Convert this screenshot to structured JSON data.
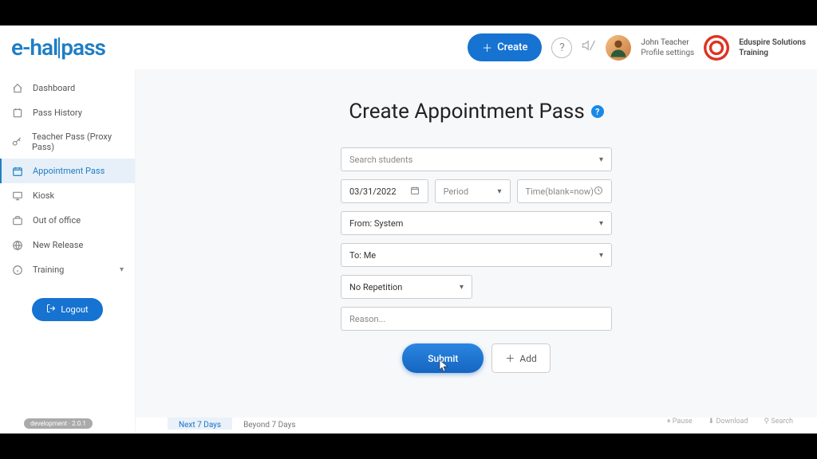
{
  "brand": "e-hallpass",
  "header": {
    "create_button": "Create",
    "user_name": "John Teacher",
    "user_sub": "Profile settings",
    "org_name": "Eduspire Solutions",
    "org_sub": "Training"
  },
  "sidebar": {
    "items": [
      {
        "label": "Dashboard"
      },
      {
        "label": "Pass History"
      },
      {
        "label": "Teacher Pass (Proxy Pass)"
      },
      {
        "label": "Appointment Pass"
      },
      {
        "label": "Kiosk"
      },
      {
        "label": "Out of office"
      },
      {
        "label": "New Release"
      },
      {
        "label": "Training"
      }
    ],
    "logout": "Logout",
    "badge": "development · 2.0.1"
  },
  "page": {
    "title": "Create Appointment Pass",
    "search_placeholder": "Search students",
    "date_value": "03/31/2022",
    "period_placeholder": "Period",
    "time_placeholder": "Time(blank=now)",
    "from_value": "From: System",
    "to_value": "To: Me",
    "repetition_value": "No Repetition",
    "reason_placeholder": "Reason...",
    "submit": "Submit",
    "add": "Add"
  },
  "tabs": {
    "tab1": "Next 7 Days",
    "tab2": "Beyond 7 Days",
    "pause": "Pause",
    "download": "Download",
    "search": "Search"
  }
}
